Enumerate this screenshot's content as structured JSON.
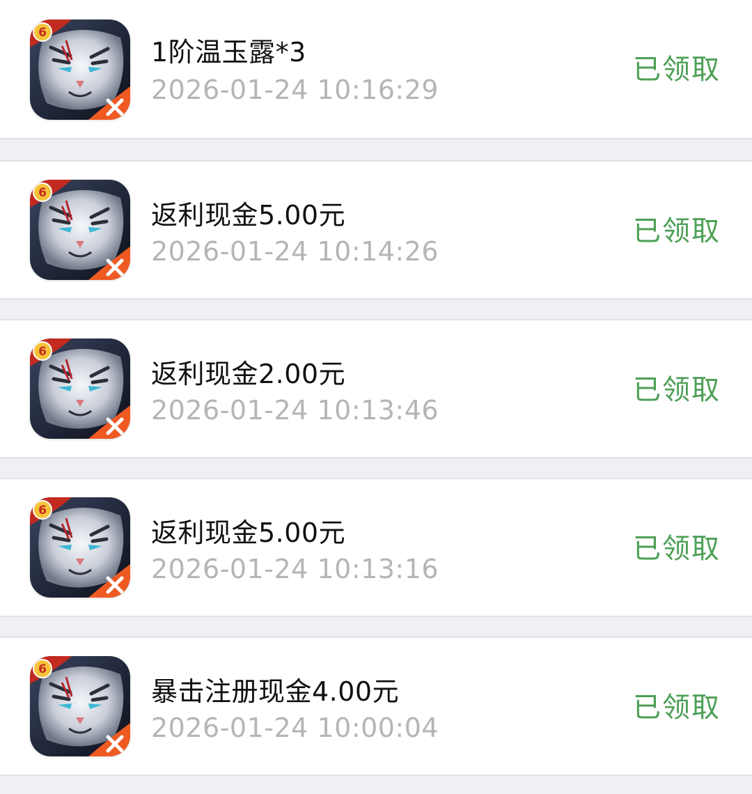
{
  "records": [
    {
      "title": "1阶温玉露*3",
      "time": "2026-01-24 10:16:29",
      "status": "已领取",
      "icon": "white-tiger-game-icon"
    },
    {
      "title": "返利现金5.00元",
      "time": "2026-01-24 10:14:26",
      "status": "已领取",
      "icon": "white-tiger-game-icon"
    },
    {
      "title": "返利现金2.00元",
      "time": "2026-01-24 10:13:46",
      "status": "已领取",
      "icon": "white-tiger-game-icon"
    },
    {
      "title": "返利现金5.00元",
      "time": "2026-01-24 10:13:16",
      "status": "已领取",
      "icon": "white-tiger-game-icon"
    },
    {
      "title": "暴击注册现金4.00元",
      "time": "2026-01-24 10:00:04",
      "status": "已领取",
      "icon": "white-tiger-game-icon"
    }
  ],
  "colors": {
    "status": "#4c9f55",
    "title": "#111111",
    "time": "#b5b5b5",
    "page_background": "#efeff4",
    "card_background": "#ffffff"
  }
}
